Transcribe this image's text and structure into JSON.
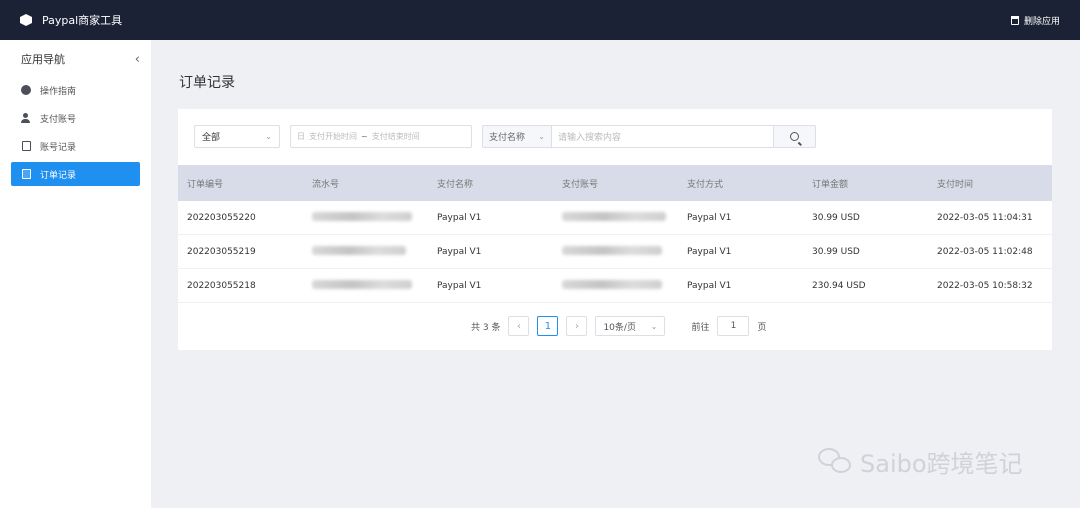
{
  "topbar": {
    "app_title": "Paypal商家工具",
    "delete_label": "删除应用"
  },
  "sidebar": {
    "title": "应用导航",
    "collapse_icon": "‹",
    "items": [
      {
        "label": "操作指南",
        "icon": "guide-icon"
      },
      {
        "label": "支付账号",
        "icon": "user-icon"
      },
      {
        "label": "账号记录",
        "icon": "account-record-icon"
      },
      {
        "label": "订单记录",
        "icon": "order-record-icon",
        "active": true
      }
    ]
  },
  "page": {
    "title": "订单记录"
  },
  "filters": {
    "status_value": "全部",
    "date_start_placeholder": "支付开始时间",
    "date_sep": "~",
    "date_end_placeholder": "支付结束时间",
    "date_prefix": "日",
    "search_type": "支付名称",
    "search_placeholder": "请输入搜索内容"
  },
  "table": {
    "columns": [
      "订单编号",
      "流水号",
      "支付名称",
      "支付账号",
      "支付方式",
      "订单金额",
      "支付时间"
    ],
    "rows": [
      {
        "order_no": "202203055220",
        "pay_name": "Paypal V1",
        "pay_method": "Paypal V1",
        "amount": "30.99 USD",
        "time": "2022-03-05 11:04:31"
      },
      {
        "order_no": "202203055219",
        "pay_name": "Paypal V1",
        "pay_method": "Paypal V1",
        "amount": "30.99 USD",
        "time": "2022-03-05 11:02:48"
      },
      {
        "order_no": "202203055218",
        "pay_name": "Paypal V1",
        "pay_method": "Paypal V1",
        "amount": "230.94 USD",
        "time": "2022-03-05 10:58:32"
      }
    ]
  },
  "pager": {
    "total": "共 3 条",
    "prev": "‹",
    "current_page": "1",
    "next": "›",
    "page_size": "10条/页",
    "goto_label": "前往",
    "goto_value": "1",
    "page_unit": "页"
  },
  "watermark": {
    "text": "Saibo跨境笔记"
  },
  "colors": {
    "topbar": "#1b2235",
    "accent": "#1f8ff0",
    "header_row": "#d8dce8"
  }
}
